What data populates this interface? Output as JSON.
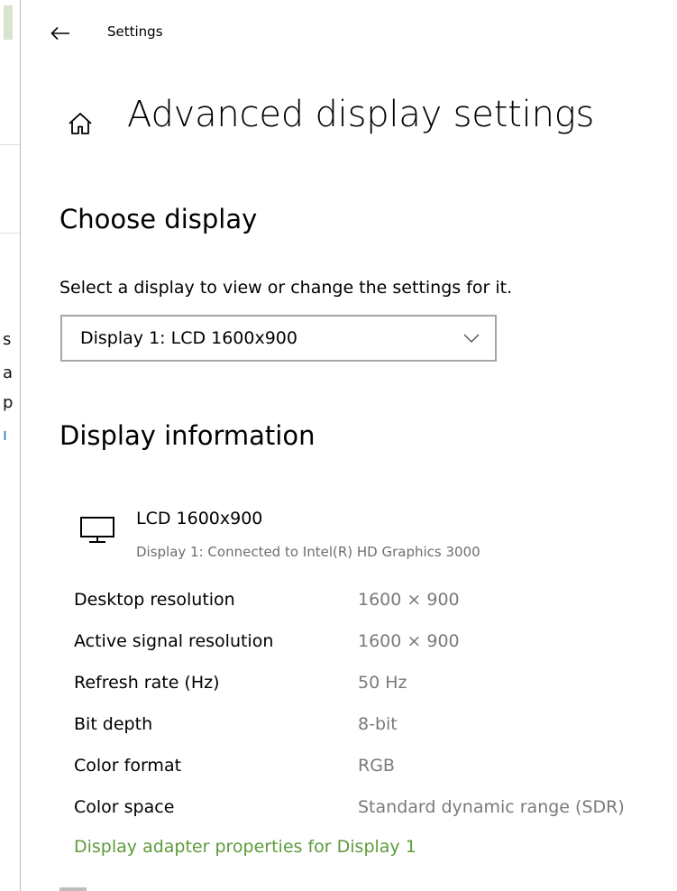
{
  "window": {
    "back_label": "Back",
    "app_title": "Settings"
  },
  "header": {
    "title": "Advanced display settings"
  },
  "choose_display": {
    "title": "Choose display",
    "description": "Select a display to view or change the settings for it.",
    "selected_display": "Display 1: LCD 1600x900"
  },
  "display_information": {
    "title": "Display information",
    "monitor_name": "LCD 1600x900",
    "monitor_connection": "Display 1: Connected to Intel(R) HD Graphics 3000",
    "rows": [
      {
        "label": "Desktop resolution",
        "value": "1600 × 900"
      },
      {
        "label": "Active signal resolution",
        "value": "1600 × 900"
      },
      {
        "label": "Refresh rate (Hz)",
        "value": "50 Hz"
      },
      {
        "label": "Bit depth",
        "value": "8-bit"
      },
      {
        "label": "Color format",
        "value": "RGB"
      },
      {
        "label": "Color space",
        "value": "Standard dynamic range (SDR)"
      }
    ],
    "adapter_link": "Display adapter properties for Display 1"
  },
  "background_window": {
    "glyphs": [
      "s",
      "a",
      "p",
      "ı"
    ]
  },
  "icons": {
    "back": "back-arrow-icon",
    "home": "home-icon",
    "dropdown": "chevron-down-icon",
    "monitor": "monitor-icon"
  },
  "colors": {
    "link": "#5d9b3b",
    "secondary_text": "#7a7a7a",
    "dropdown_border": "#a6a6a6"
  }
}
